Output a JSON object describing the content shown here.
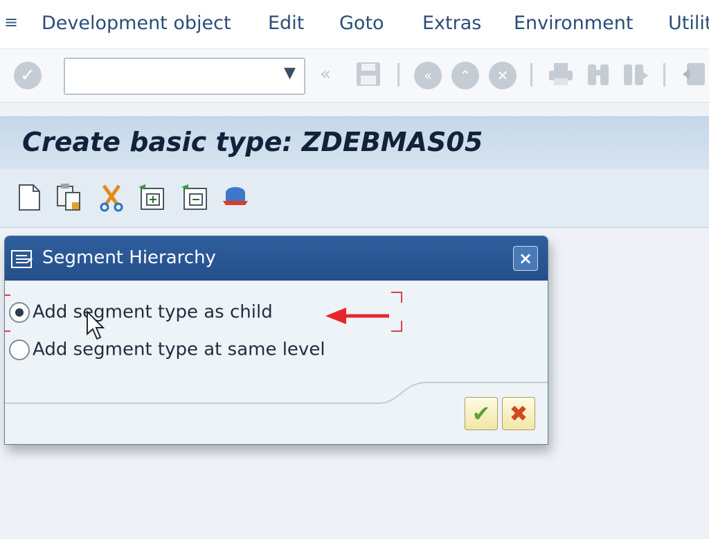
{
  "menu": {
    "items": [
      {
        "label": "Development object"
      },
      {
        "label": "Edit"
      },
      {
        "label": "Goto"
      },
      {
        "label": "Extras"
      },
      {
        "label": "Environment"
      },
      {
        "label": "Utilit"
      }
    ]
  },
  "toolbar": {
    "command_field_value": "",
    "icons": [
      "enter-icon",
      "dropdown-icon",
      "back-chevron-icon",
      "save-icon",
      "back-icon",
      "exit-icon",
      "cancel-icon",
      "print-icon",
      "find-icon",
      "find-next-icon",
      "first-page-icon"
    ]
  },
  "page": {
    "title": "Create basic type: ZDEBMAS05"
  },
  "app_toolbar": {
    "icons": [
      "new-document-icon",
      "copy-icon",
      "cut-icon",
      "insert-segment-icon",
      "delete-segment-icon",
      "segment-editor-icon"
    ]
  },
  "dialog": {
    "title": "Segment Hierarchy",
    "options": [
      {
        "label": "Add segment type as child",
        "selected": true
      },
      {
        "label": "Add segment type at same level",
        "selected": false
      }
    ],
    "close_label": "×",
    "ok_label": "✔",
    "cancel_label": "✖"
  },
  "colors": {
    "dialog_header": "#2f5f9e",
    "annotation": "#e8262a",
    "ok_green": "#5ba332",
    "cancel_orange": "#d3491f"
  }
}
